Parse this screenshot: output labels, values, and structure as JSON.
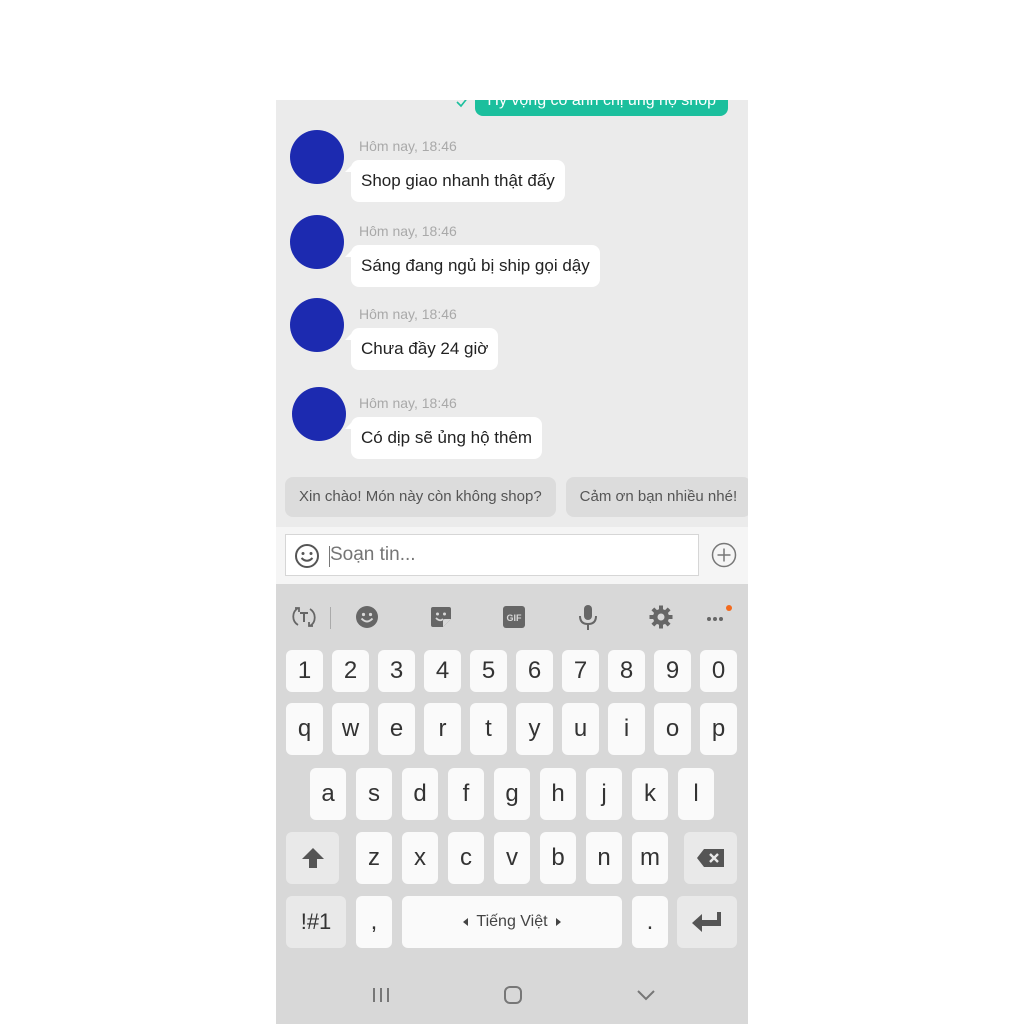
{
  "chat": {
    "sent_message": {
      "text": "Hy vọng có anh chị ủng hộ shop",
      "status_icon": "check-icon",
      "color": "#1bbf9d"
    },
    "messages": [
      {
        "time": "Hôm nay, 18:46",
        "text": "Shop giao nhanh thật đấy"
      },
      {
        "time": "Hôm nay, 18:46",
        "text": "Sáng đang ngủ bị ship gọi dậy"
      },
      {
        "time": "Hôm nay, 18:46",
        "text": "Chưa đầy 24 giờ"
      },
      {
        "time": "Hôm nay, 18:46",
        "text": "Có dịp sẽ ủng hộ thêm"
      }
    ],
    "avatar_color": "#1c2ab0"
  },
  "quick_replies": [
    "Xin chào! Món này còn không shop?",
    "Cảm ơn bạn nhiều nhé!"
  ],
  "composer": {
    "placeholder": "Soạn tin...",
    "value": "",
    "emoji_icon": "smiley-icon",
    "add_icon": "plus-circle-icon"
  },
  "keyboard": {
    "toolbar": [
      "text-translate-icon",
      "emoji-icon",
      "sticker-icon",
      "gif-icon",
      "microphone-icon",
      "settings-gear-icon",
      "more-options-icon"
    ],
    "gif_label": "GIF",
    "notification_dot_color": "#f36a1d",
    "rows": {
      "numbers": [
        "1",
        "2",
        "3",
        "4",
        "5",
        "6",
        "7",
        "8",
        "9",
        "0"
      ],
      "row1": [
        "q",
        "w",
        "e",
        "r",
        "t",
        "y",
        "u",
        "i",
        "o",
        "p"
      ],
      "row2": [
        "a",
        "s",
        "d",
        "f",
        "g",
        "h",
        "j",
        "k",
        "l"
      ],
      "row3": [
        "z",
        "x",
        "c",
        "v",
        "b",
        "n",
        "m"
      ]
    },
    "symbols_label": "!#1",
    "comma_label": ",",
    "space_label": "Tiếng Việt",
    "period_label": ".",
    "shift_icon": "shift-arrow-icon",
    "backspace_icon": "backspace-icon",
    "enter_icon": "enter-icon"
  },
  "navigation": {
    "recent_apps_icon": "recent-apps-icon",
    "home_icon": "home-icon",
    "back_icon": "hide-keyboard-chevron-icon"
  }
}
